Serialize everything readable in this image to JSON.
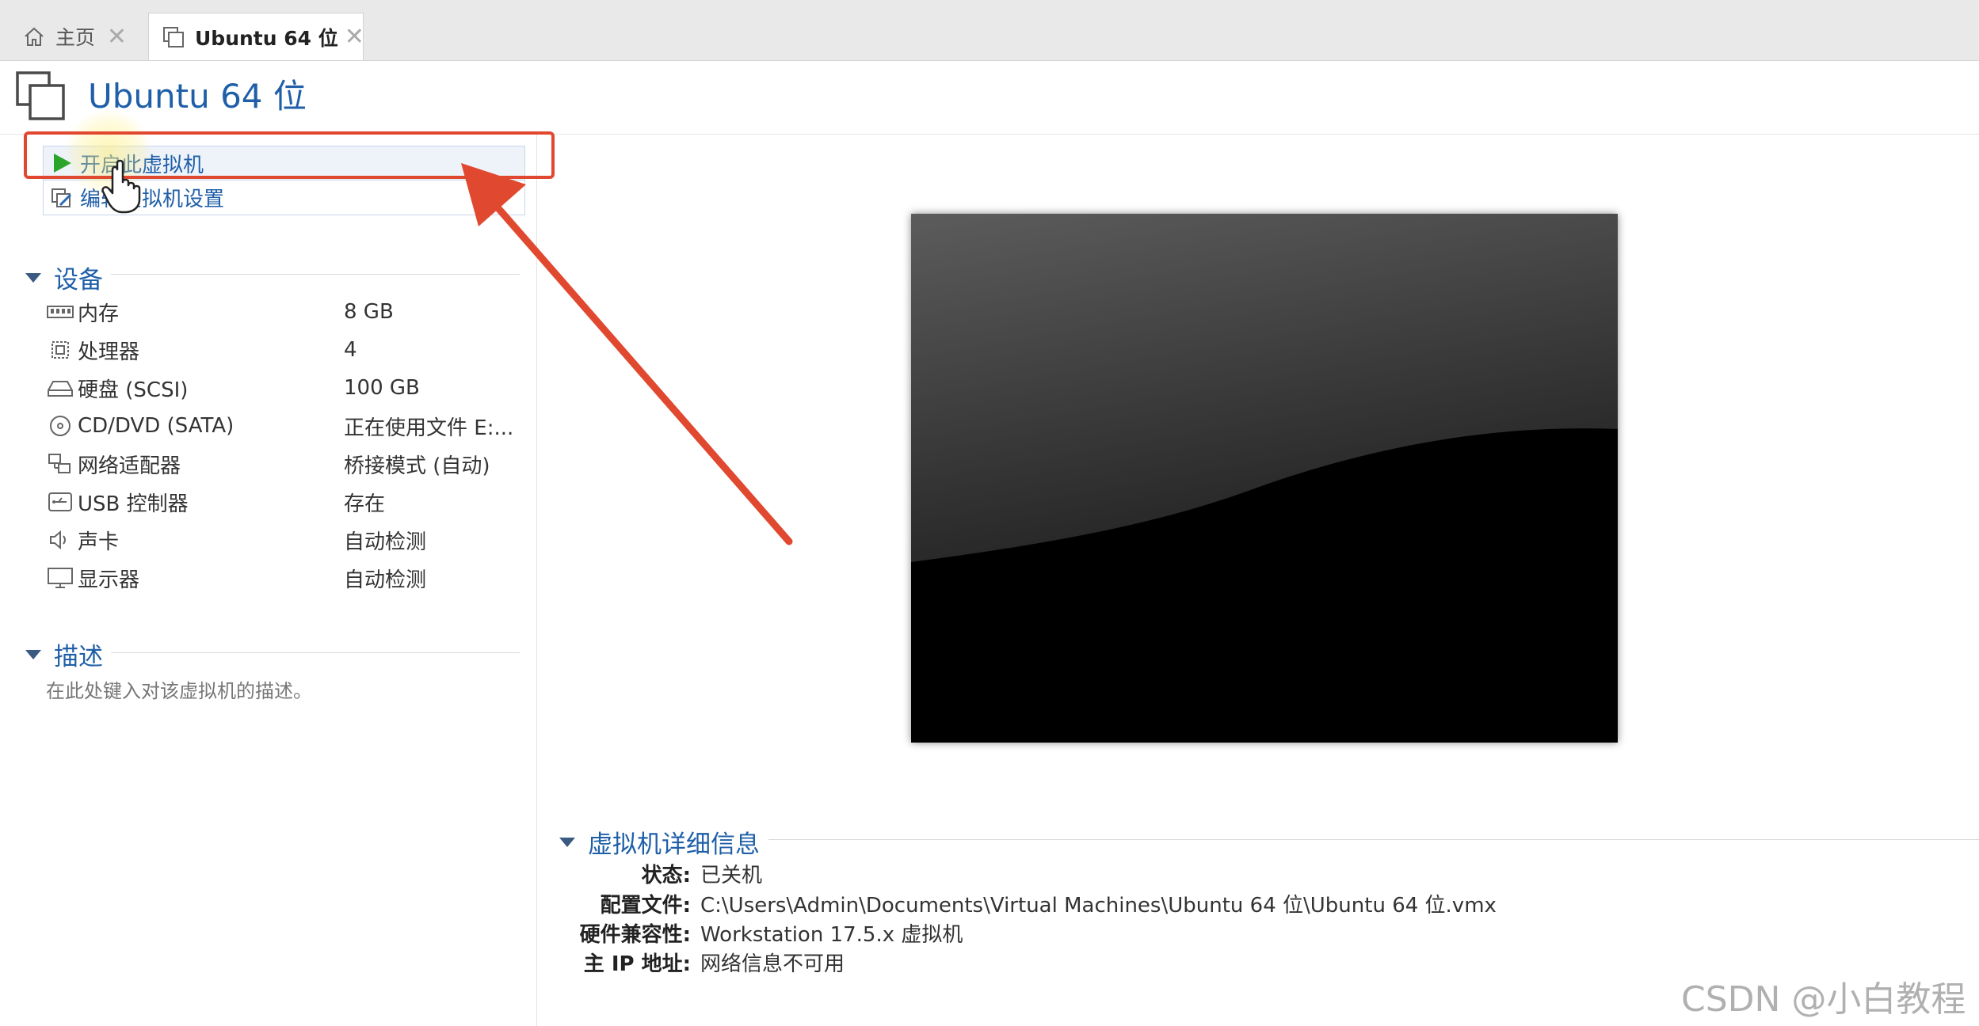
{
  "tabs": [
    {
      "label": "主页",
      "icon": "home-icon",
      "close": "✕"
    },
    {
      "label": "Ubuntu 64 位",
      "icon": "vm-icon",
      "close": "✕"
    }
  ],
  "vm": {
    "title": "Ubuntu 64 位"
  },
  "actions": {
    "power_on": "开启此虚拟机",
    "edit_settings": "编辑虚拟机设置"
  },
  "devices": {
    "header": "设备",
    "items": [
      {
        "name": "内存",
        "value": "8 GB",
        "icon": "memory-icon"
      },
      {
        "name": "处理器",
        "value": "4",
        "icon": "processor-icon"
      },
      {
        "name": "硬盘 (SCSI)",
        "value": "100 GB",
        "icon": "harddisk-icon"
      },
      {
        "name": "CD/DVD (SATA)",
        "value": "正在使用文件 E:...",
        "icon": "cd-icon"
      },
      {
        "name": "网络适配器",
        "value": "桥接模式 (自动)",
        "icon": "network-icon"
      },
      {
        "name": "USB 控制器",
        "value": "存在",
        "icon": "usb-icon"
      },
      {
        "name": "声卡",
        "value": "自动检测",
        "icon": "sound-icon"
      },
      {
        "name": "显示器",
        "value": "自动检测",
        "icon": "display-icon"
      }
    ]
  },
  "description": {
    "header": "描述",
    "placeholder": "在此处键入对该虚拟机的描述。"
  },
  "details": {
    "header": "虚拟机详细信息",
    "rows": [
      {
        "label": "状态:",
        "value": "已关机"
      },
      {
        "label": "配置文件:",
        "value": "C:\\Users\\Admin\\Documents\\Virtual Machines\\Ubuntu 64 位\\Ubuntu 64 位.vmx"
      },
      {
        "label": "硬件兼容性:",
        "value": "Workstation 17.5.x 虚拟机"
      },
      {
        "label": "主 IP 地址:",
        "value": "网络信息不可用"
      }
    ]
  },
  "watermark": "CSDN @小白教程",
  "colors": {
    "accent": "#1f5fa8",
    "annotation": "#e0492f",
    "play": "#2aa52a"
  }
}
